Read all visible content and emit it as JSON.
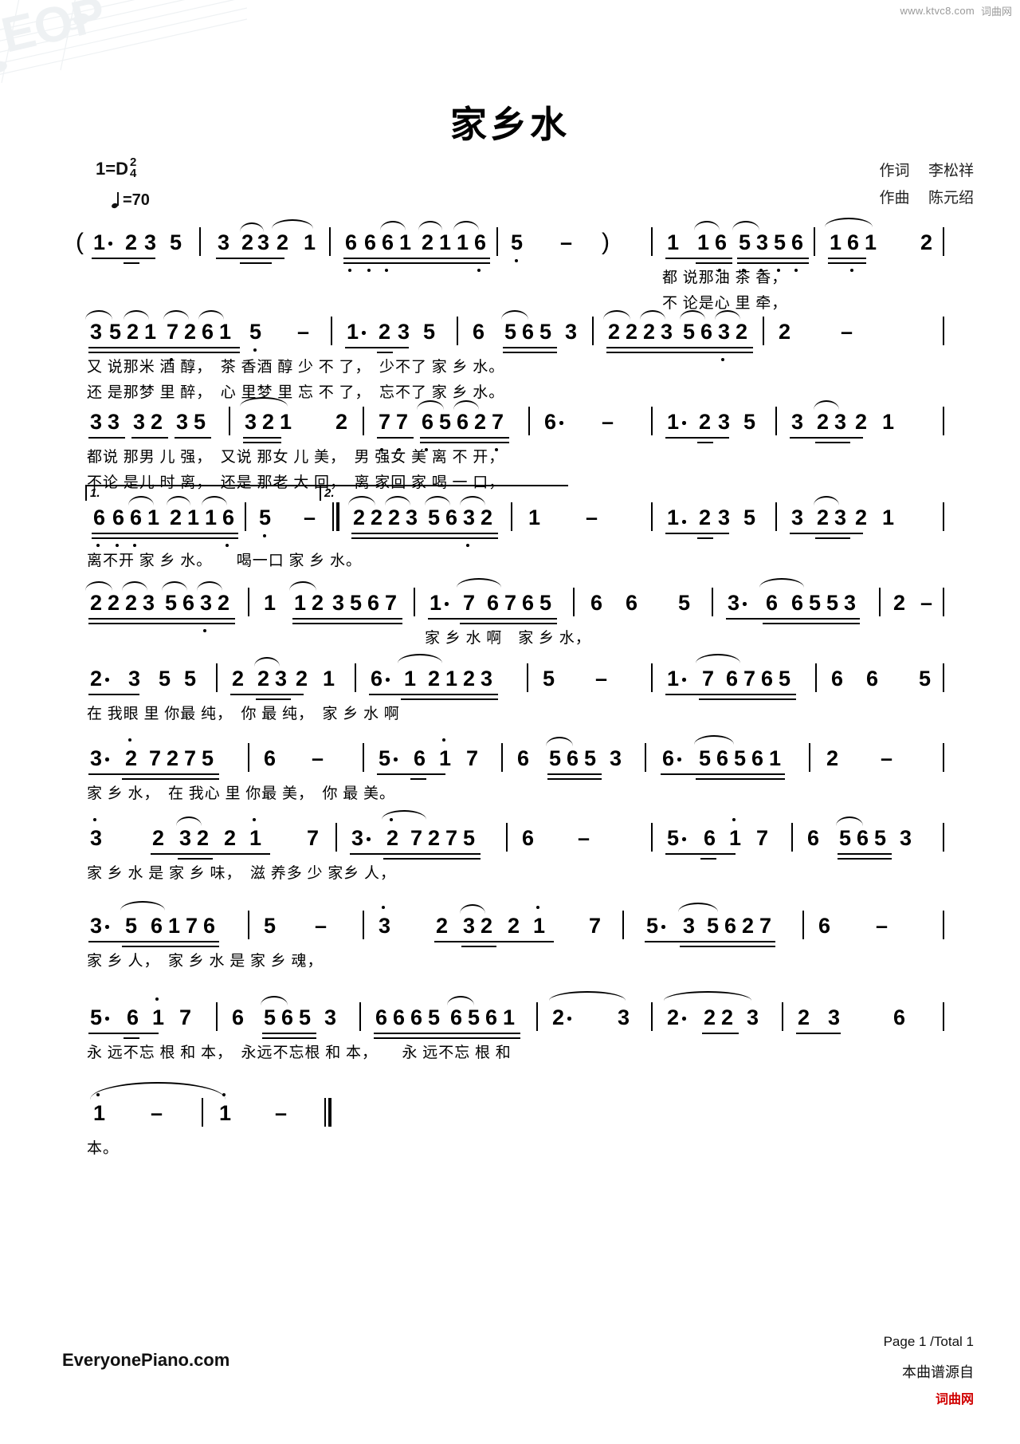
{
  "topbar": {
    "site_code": "www.ktvc8.com",
    "site_name": "词曲网"
  },
  "header": {
    "title": "家乡水",
    "key_label": "1=D",
    "time_num": "2",
    "time_den": "4",
    "tempo_label": "=70",
    "lyricist_role": "作词",
    "lyricist_name": "李松祥",
    "composer_role": "作曲",
    "composer_name": "陈元绍"
  },
  "footer": {
    "brand": "EveryonePiano.com",
    "page": "Page 1 /Total 1",
    "source_prefix": "本曲谱源自",
    "source_site": "词曲网"
  },
  "watermark": {
    "text": "EOP"
  },
  "score": {
    "lines": [
      {
        "id": "line-1",
        "notes": "( 1· 2 3 5 | 3 23 2 1 | 6661 2116 | 5 -  )  | 1 16 5356 | 161  2 |",
        "lyrics_1": "都 说那油 茶 香，",
        "lyrics_2": "不 论是心 里 牵，"
      },
      {
        "id": "line-2",
        "notes": "3521 7261 | 5 - | 1· 2 3 5 | 6 565 3 | 2223 5632 | 2 - |",
        "lyrics_1": "又 说那米 酒 醇，　茶 香酒 醇 少 不 了，　少不了 家 乡 水。",
        "lyrics_2": "还 是那梦 里 醉，　心 里梦 里 忘 不 了，　忘不了 家 乡 水。"
      },
      {
        "id": "line-3",
        "notes": "33 32 35 | 321  2 | 77 65627 | 6· - | 1· 2 3 5 | 3 23 2 1 |",
        "lyrics_1": "都说 那男 儿 强，　又说 那女 儿 美，　男 强女 美 离 不 开，",
        "lyrics_2": "不论 是儿 时 离，　还是 那老 大 回，　离 家回 家 喝 一 口，"
      },
      {
        "id": "line-4",
        "notes": "1. 6661 2116 | 5 - :| 2. 2223 5632 | 1 - | 1· 2 3 5 | 3 23 2 1 |",
        "lyrics_1": "离不开 家 乡 水。　　喝一口 家 乡 水。"
      },
      {
        "id": "line-5",
        "notes": "2223 5632 | 1 12 3567 | 1· 7 6765 | 6 6  5 | 3· 6 6553 | 2 - |",
        "lyrics_1": "家 乡 水 啊　家 乡 水，"
      },
      {
        "id": "line-6",
        "notes": "2· 3 5 5 | 2 23 2 1 | 6· 1 2123 | 5 - | 1· 7 6765 | 6 6  5 |",
        "lyrics_1": "在 我眼 里 你最 纯，　你 最 纯，　家 乡 水 啊"
      },
      {
        "id": "line-7",
        "notes": "3· 2 7275 | 6 - | 5· 6 1 7 | 6 565 3 | 6· 56561 | 2 - |",
        "lyrics_1": "家 乡 水，　在 我心 里 你最 美，　你 最 美。"
      },
      {
        "id": "line-8",
        "notes": "3  2 32 2 1  7 | 3· 2 7275 | 6 - | 5· 6 1 7 | 6 565 3 |",
        "lyrics_1": "家 乡 水 是 家 乡 味，　滋 养多 少 家乡 人，"
      },
      {
        "id": "line-9",
        "notes": "3· 5 6176 | 5 - | 3  2 32 2 1  7 | 5· 3 5627 | 6 - |",
        "lyrics_1": "家 乡 人，　家 乡 水 是 家 乡 魂，"
      },
      {
        "id": "line-10",
        "notes": "5· 6 1 7 | 6 565 3 | 6665 6561 | 2· 3 | 2· 223 | 2 3  6 |",
        "lyrics_1": "永 远不忘 根 和 本，　永远不忘根 和 本，　　永 远不忘 根 和"
      },
      {
        "id": "line-11",
        "notes": "1 - | 1 - ‖",
        "lyrics_1": "本。"
      }
    ]
  }
}
